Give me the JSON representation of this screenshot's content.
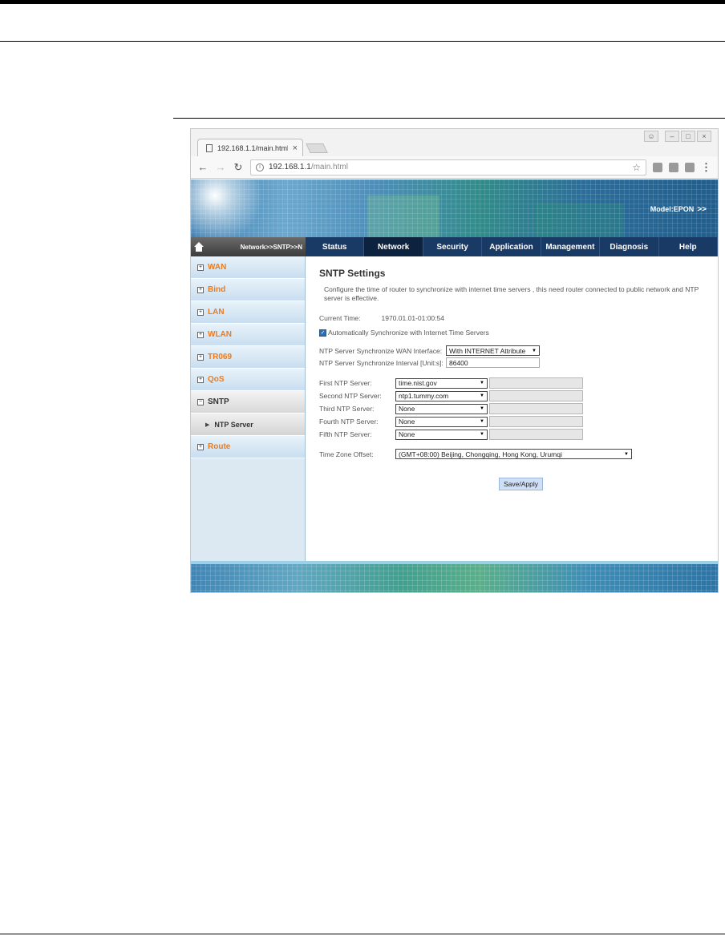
{
  "browser": {
    "tab_title": "192.168.1.1/main.html",
    "tab_close": "×",
    "url_host": "192.168.1.1",
    "url_path": "/main.html"
  },
  "banner": {
    "model_label": "Model:EPON",
    "model_arrows": ">>"
  },
  "breadcrumb": "Network>>SNTP>>N",
  "nav_tabs": [
    "Status",
    "Network",
    "Security",
    "Application",
    "Management",
    "Diagnosis",
    "Help"
  ],
  "nav_active": "Network",
  "sidebar": {
    "items": [
      {
        "label": "WAN",
        "toggle": "+"
      },
      {
        "label": "Bind",
        "toggle": "+"
      },
      {
        "label": "LAN",
        "toggle": "+"
      },
      {
        "label": "WLAN",
        "toggle": "+"
      },
      {
        "label": "TR069",
        "toggle": "+"
      },
      {
        "label": "QoS",
        "toggle": "+"
      },
      {
        "label": "SNTP",
        "toggle": "−"
      },
      {
        "label": "Route",
        "toggle": "+"
      }
    ],
    "sub_item": "NTP Server"
  },
  "content": {
    "title": "SNTP Settings",
    "description": "Configure the time of router to synchronize with internet time servers , this need router connected to public network and NTP server is effective.",
    "current_time_label": "Current Time:",
    "current_time_value": "1970.01.01-01:00:54",
    "auto_sync_label": "Automatically Synchronize with Internet Time Servers",
    "wan_interface_label": "NTP Server Synchronize WAN Interface:",
    "wan_interface_value": "With INTERNET Attribute",
    "interval_label": "NTP Server Synchronize Interval [Unit:s]:",
    "interval_value": "86400",
    "ntp_servers": [
      {
        "label": "First NTP Server:",
        "value": "time.nist.gov"
      },
      {
        "label": "Second NTP Server:",
        "value": "ntp1.tummy.com"
      },
      {
        "label": "Third NTP Server:",
        "value": "None"
      },
      {
        "label": "Fourth NTP Server:",
        "value": "None"
      },
      {
        "label": "Fifth NTP Server:",
        "value": "None"
      }
    ],
    "timezone_label": "Time Zone Offset:",
    "timezone_value": "(GMT+08:00) Beijing, Chongqing, Hong Kong, Urumqi",
    "save_label": "Save/Apply"
  }
}
